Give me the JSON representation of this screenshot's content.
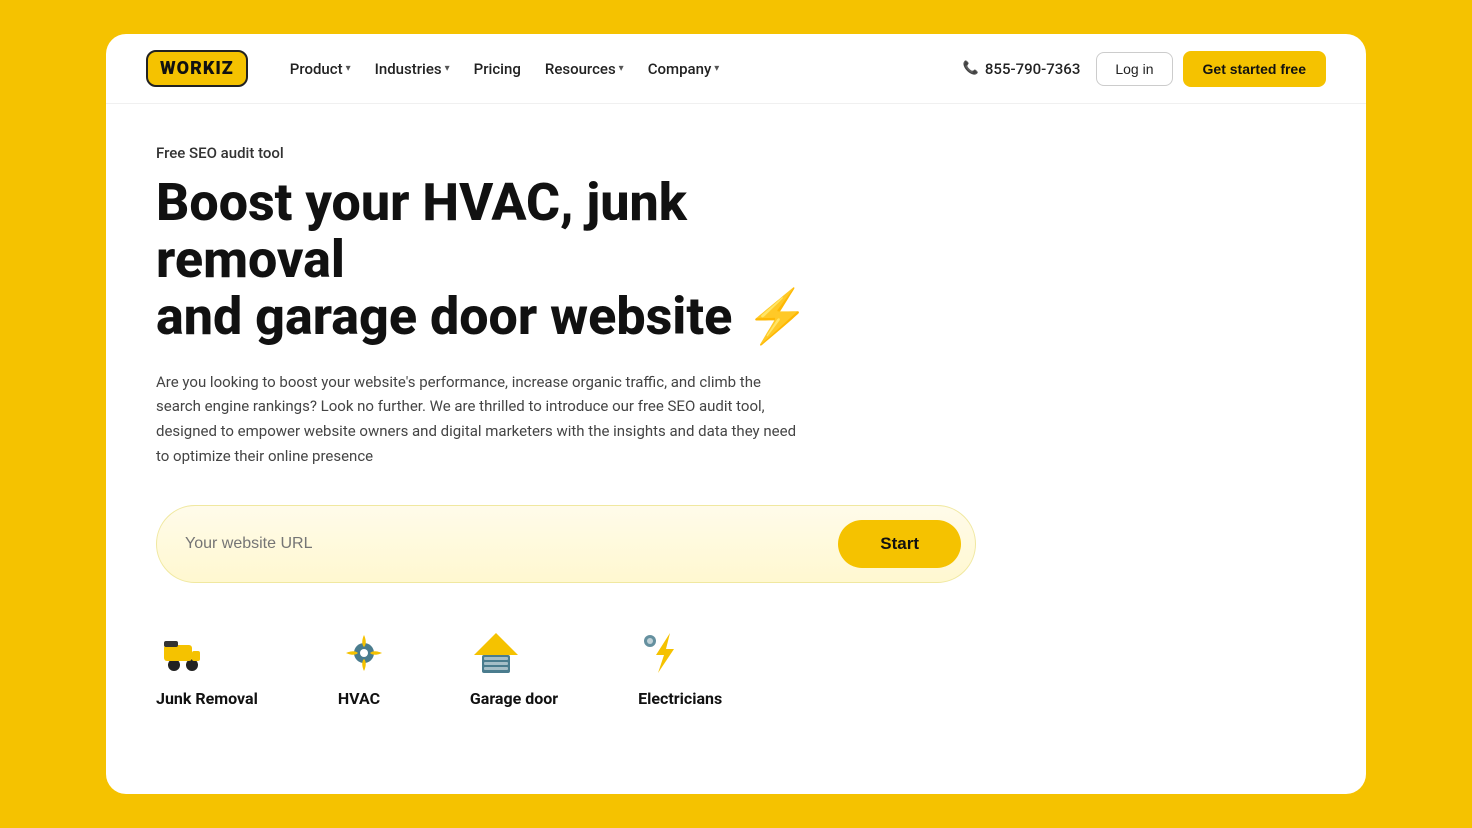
{
  "logo": {
    "text": "WORKIZ"
  },
  "nav": {
    "product_label": "Product",
    "industries_label": "Industries",
    "pricing_label": "Pricing",
    "resources_label": "Resources",
    "company_label": "Company",
    "phone": "855-790-7363",
    "login_label": "Log in",
    "get_started_label": "Get started free"
  },
  "hero": {
    "eyebrow": "Free SEO audit tool",
    "headline_part1": "Boost your HVAC, junk removal",
    "headline_part2": "and garage door website",
    "headline_emoji": "⚡",
    "description": "Are you looking to boost your website's performance, increase organic traffic, and climb the search engine rankings? Look no further. We are thrilled to introduce our free SEO audit tool, designed to empower website owners and digital marketers with the insights and data they need to optimize their online presence",
    "url_placeholder": "Your website URL",
    "start_button": "Start"
  },
  "industries": [
    {
      "id": "junk-removal",
      "label": "Junk Removal",
      "icon": "junk"
    },
    {
      "id": "hvac",
      "label": "HVAC",
      "icon": "hvac"
    },
    {
      "id": "garage-door",
      "label": "Garage door",
      "icon": "garage"
    },
    {
      "id": "electricians",
      "label": "Electricians",
      "icon": "electrician"
    }
  ]
}
